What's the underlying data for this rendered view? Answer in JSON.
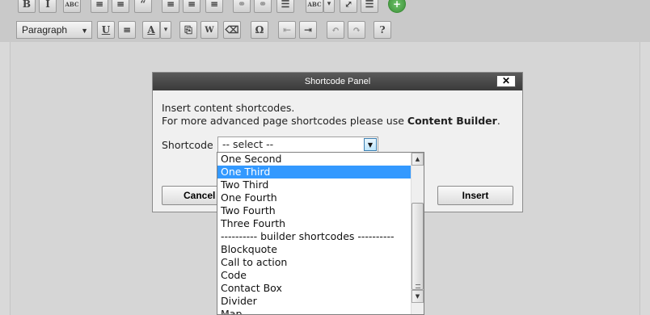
{
  "toolbar": {
    "row1_buttons": [
      "B",
      "I",
      "ABC",
      "≡",
      "≡",
      "“",
      "≡",
      "≡",
      "≡",
      "⚭",
      "⚭",
      "☰",
      "ABC",
      "▾",
      "⤢",
      "☰",
      "+"
    ],
    "format_select": "Paragraph",
    "row2_buttons": [
      "U",
      "≡",
      "A",
      "▾",
      "⎘",
      "W",
      "⌫",
      "Ω",
      "⇤",
      "⇥",
      "↶",
      "↷",
      "?"
    ]
  },
  "dialog": {
    "title": "Shortcode Panel",
    "close_label": "✕",
    "line1": "Insert content shortcodes.",
    "line2_prefix": "For more advanced page shortcodes please use ",
    "line2_bold": "Content Builder",
    "line2_suffix": ".",
    "field_label": "Shortcode",
    "select_value": "-- select --",
    "cancel_label": "Cancel",
    "insert_label": "Insert"
  },
  "dropdown": {
    "options": [
      "One Second",
      "One Third",
      "Two Third",
      "One Fourth",
      "Two Fourth",
      "Three Fourth",
      "---------- builder shortcodes ----------",
      "Blockquote",
      "Call to action",
      "Code",
      "Contact Box",
      "Divider",
      "Map"
    ],
    "highlighted": "One Third"
  },
  "colors": {
    "highlight": "#3399ff",
    "title_bar": "#3a3a3a",
    "dialog_bg": "#f0f0f0"
  }
}
